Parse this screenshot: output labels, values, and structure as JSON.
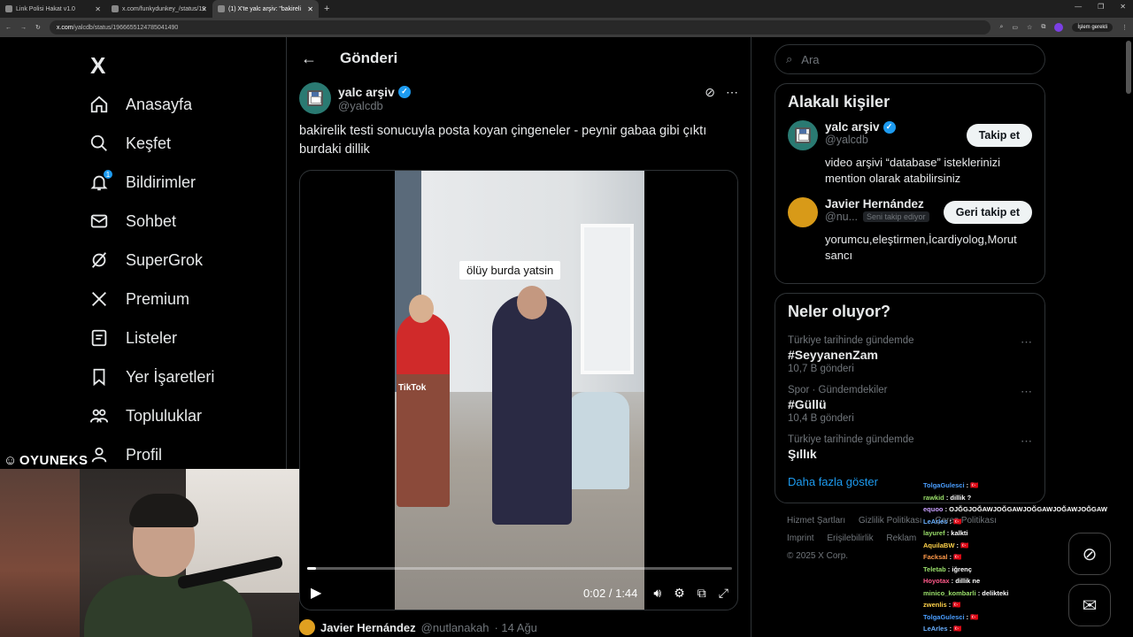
{
  "browser": {
    "tabs": [
      {
        "title": "Link Polisi Hakat v1.0",
        "active": false
      },
      {
        "title": "x.com/funkydunkey_/status/19",
        "active": false
      },
      {
        "title": "(1) X'te yalc arşiv: \"bakireli",
        "active": true
      }
    ],
    "url_host": "x.com",
    "url_path": "/yalcdb/status/1966655124785041490",
    "profile_pill": "İşlem gerekli"
  },
  "nav": {
    "logo": "X",
    "items": [
      {
        "label": "Anasayfa",
        "icon": "home-icon"
      },
      {
        "label": "Keşfet",
        "icon": "search-icon"
      },
      {
        "label": "Bildirimler",
        "icon": "bell-icon",
        "badge": "1"
      },
      {
        "label": "Sohbet",
        "icon": "mail-icon"
      },
      {
        "label": "SuperGrok",
        "icon": "grok-icon"
      },
      {
        "label": "Premium",
        "icon": "x-icon"
      },
      {
        "label": "Listeler",
        "icon": "list-icon"
      },
      {
        "label": "Yer İşaretleri",
        "icon": "bookmark-icon"
      },
      {
        "label": "Topluluklar",
        "icon": "people-icon"
      },
      {
        "label": "Profil",
        "icon": "person-icon"
      }
    ]
  },
  "main": {
    "header_title": "Gönderi",
    "post": {
      "author_name": "yalc arşiv",
      "author_handle": "@yalcdb",
      "text_line1": "bakirelik testi sonucuyla posta koyan çingeneler - peynir gabaa gibi çıktı",
      "text_line2": "burdaki dillik",
      "video": {
        "caption": "ölüy burda yatsin",
        "watermark": "TikTok",
        "time": "0:02 / 1:44",
        "progress": 0.02
      }
    },
    "reply": {
      "name": "Javier Hernández",
      "handle": "@nutlanakah",
      "date": "· 14 Ağu"
    }
  },
  "right": {
    "search_placeholder": "Ara",
    "related": {
      "title": "Alakalı kişiler",
      "people": [
        {
          "name": "yalc arşiv",
          "handle": "@yalcdb",
          "bio": "video arşivi “database” isteklerinizi mention olarak atabilirsiniz",
          "button": "Takip et",
          "follows_you": ""
        },
        {
          "name": "Javier Hernández",
          "handle": "@nu...",
          "bio": "yorumcu,eleştirmen,İcardiyolog,Morut sancı",
          "button": "Geri takip et",
          "follows_you": "Seni takip ediyor"
        }
      ]
    },
    "trends": {
      "title": "Neler oluyor?",
      "items": [
        {
          "meta": "Türkiye tarihinde gündemde",
          "name": "#SeyyanenZam",
          "count": "10,7 B gönderi"
        },
        {
          "meta": "Spor · Gündemdekiler",
          "name": "#Güllü",
          "count": "10,4 B gönderi"
        },
        {
          "meta": "Türkiye tarihinde gündemde",
          "name": "Şıllık",
          "count": ""
        }
      ],
      "show_more": "Daha fazla göster"
    },
    "footer": {
      "line1": [
        "Hizmet Şartları",
        "Gizlilik Politikası",
        "Çerez Politikası"
      ],
      "line2": [
        "Imprint",
        "Erişilebilirlik",
        "Reklam"
      ],
      "copyright": "© 2025 X Corp."
    }
  },
  "overlay": {
    "logo_text": "OYUNEKS",
    "chat": [
      {
        "user": "TolgaGulesci",
        "text": ": 🇹🇷",
        "color": "#4a9eff"
      },
      {
        "user": "rawkid",
        "text": ": dillik ?",
        "color": "#9adf6a"
      },
      {
        "user": "equoo",
        "text": ": OJĞGJOĞAWJOĞGAWJOĞGAWJOĞAWJOĞGAW",
        "color": "#c9a0ff"
      },
      {
        "user": "LeArles",
        "text": ": 🇹🇷",
        "color": "#6ab0ff"
      },
      {
        "user": "layuref",
        "text": ": kalkti",
        "color": "#9adf6a"
      },
      {
        "user": "AquilaBW",
        "text": ": 🇹🇷",
        "color": "#ffd24a"
      },
      {
        "user": "Facksal",
        "text": ": 🇹🇷",
        "color": "#ff9a4a"
      },
      {
        "user": "Teletab",
        "text": ": iğrenç",
        "color": "#9adf6a"
      },
      {
        "user": "Hoyotax",
        "text": ": dillik ne",
        "color": "#ff5a8a"
      },
      {
        "user": "minico_kombarli",
        "text": ": delikteki",
        "color": "#9adf6a"
      },
      {
        "user": "zwenlis",
        "text": ": 🇹🇷",
        "color": "#ffd24a"
      },
      {
        "user": "TolgaGulesci",
        "text": ": 🇹🇷",
        "color": "#4a9eff"
      },
      {
        "user": "LeArles",
        "text": ": 🇹🇷",
        "color": "#6ab0ff"
      }
    ]
  }
}
